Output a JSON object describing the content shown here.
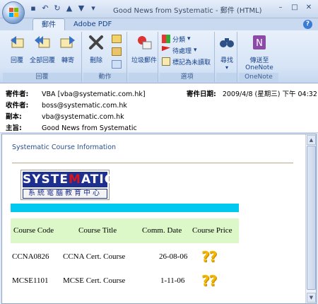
{
  "window": {
    "title": "Good News from Systematic - 郵件 (HTML)"
  },
  "tabs": [
    {
      "label": "郵件",
      "active": true
    },
    {
      "label": "Adobe PDF",
      "active": false
    }
  ],
  "ribbon": {
    "groups": {
      "respond": {
        "label": "回覆",
        "buttons": [
          "回覆",
          "全部回覆",
          "轉寄"
        ]
      },
      "actions": {
        "label": "動作",
        "buttons": [
          "刪除"
        ]
      },
      "junk": {
        "buttons": [
          "垃圾郵件"
        ]
      },
      "options": {
        "label": "選項",
        "items": [
          "分類",
          "待處理",
          "標記為未讀取"
        ]
      },
      "find": {
        "buttons": [
          "尋找"
        ]
      },
      "onenote": {
        "label": "OneNote",
        "button": "傳送至 OneNote"
      }
    }
  },
  "headers": {
    "from_label": "寄件者:",
    "from_value": "VBA [vba@systematic.com.hk]",
    "date_label": "寄件日期:",
    "date_value": "2009/4/8 (星期三) 下午 04:32",
    "to_label": "收件者:",
    "to_value": "boss@systematic.com.hk",
    "cc_label": "副本:",
    "cc_value": "vba@systematic.com.hk",
    "subject_label": "主旨:",
    "subject_value": "Good News from Systematic"
  },
  "body": {
    "section_title": "Systematic Course Information",
    "logo": {
      "top_text_1": "SYSTE",
      "top_text_2": "M",
      "top_text_3": "ATIC",
      "bottom_text": "系統電腦教育中心"
    },
    "table": {
      "columns": [
        "Course Code",
        "Course Title",
        "Comm. Date",
        "Course Price"
      ],
      "rows": [
        {
          "code": "CCNA0826",
          "title": "CCNA Cert. Course",
          "date": "26-08-06",
          "price": "??"
        },
        {
          "code": "MCSE1101",
          "title": "MCSE Cert. Course",
          "date": "1-11-06",
          "price": "??"
        }
      ]
    }
  },
  "colors": {
    "accent_cyan": "#00c8ef",
    "header_green": "#dcf7c8",
    "logo_blue": "#1d2f8f",
    "logo_red": "#d8131b",
    "question_gold": "#f2b800"
  }
}
